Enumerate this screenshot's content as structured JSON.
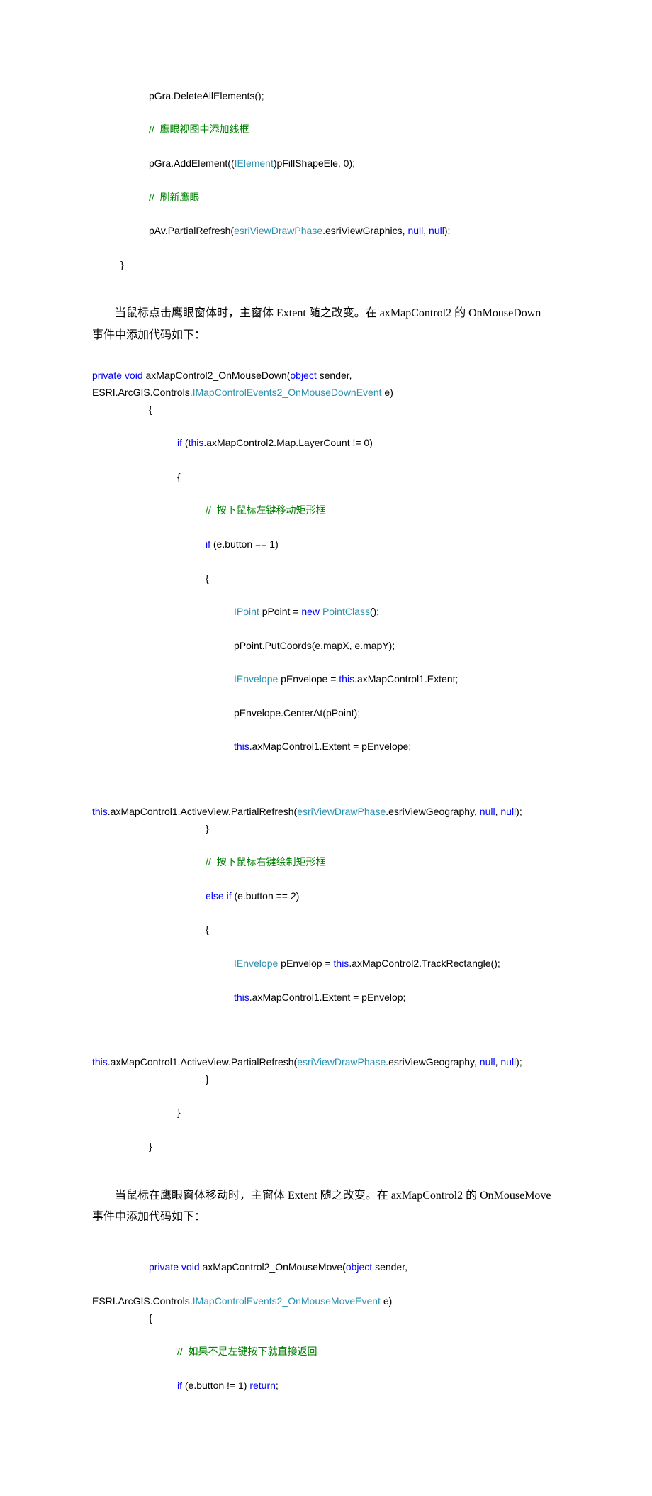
{
  "block1": {
    "l1": "pGra.DeleteAllElements();",
    "l2": "//  鹰眼视图中添加线框",
    "l3a": "pGra.AddElement((",
    "l3b": "IElement",
    "l3c": ")pFillShapeEle, 0);",
    "l4": "//  刷新鹰眼",
    "l5a": "pAv.PartialRefresh(",
    "l5b": "esriViewDrawPhase",
    "l5c": ".esriViewGraphics, ",
    "l5d": "null",
    "l5e": ", ",
    "l5f": "null",
    "l5g": ");",
    "l6": "}"
  },
  "para1": {
    "t1": "当鼠标点击鹰眼窗体时，主窗体 Extent 随之改变。在 axMapControl2 的 OnMouseDown事件中添加代码如下：",
    "t1_first": "当鼠标点击鹰眼窗体时，主窗体 Extent 随之改变。在 axMapControl2 的 OnMouseDown",
    "t1_rest": "事件中添加代码如下："
  },
  "block2": {
    "sig1a": "private",
    "sig1b": " ",
    "sig1c": "void",
    "sig1d": " axMapControl2_OnMouseDown(",
    "sig1e": "object",
    "sig1f": " sender,",
    "sig2a": "ESRI.ArcGIS.Controls.",
    "sig2b": "IMapControlEvents2_OnMouseDownEvent",
    "sig2c": " e)",
    "l1": "{",
    "l2a": "if",
    "l2b": " (",
    "l2c": "this",
    "l2d": ".axMapControl2.Map.LayerCount != 0)",
    "l3": "{",
    "l4": "//  按下鼠标左键移动矩形框",
    "l5a": "if",
    "l5b": " (e.button == 1)",
    "l6": "{",
    "l7a": "IPoint",
    "l7b": " pPoint = ",
    "l7c": "new",
    "l7d": " ",
    "l7e": "PointClass",
    "l7f": "();",
    "l8": "pPoint.PutCoords(e.mapX, e.mapY);",
    "l9a": "IEnvelope",
    "l9b": " pEnvelope = ",
    "l9c": "this",
    "l9d": ".axMapControl1.Extent;",
    "l10": "pEnvelope.CenterAt(pPoint);",
    "l11a": "this",
    "l11b": ".axMapControl1.Extent = pEnvelope;",
    "l12a": "this",
    "l12b": ".axMapControl1.ActiveView.PartialRefresh(",
    "l12c": "esriViewDrawPhase",
    "l12d": ".esriViewGeography, ",
    "l12e": "null",
    "l12f": ", ",
    "l12g": "null",
    "l12h": ");",
    "l13": "}",
    "l14": "//  按下鼠标右键绘制矩形框",
    "l15a": "else",
    "l15b": " ",
    "l15c": "if",
    "l15d": " (e.button == 2)",
    "l16": "{",
    "l17a": "IEnvelope",
    "l17b": " pEnvelop = ",
    "l17c": "this",
    "l17d": ".axMapControl2.TrackRectangle();",
    "l18a": "this",
    "l18b": ".axMapControl1.Extent = pEnvelop;",
    "l19a": "this",
    "l19b": ".axMapControl1.ActiveView.PartialRefresh(",
    "l19c": "esriViewDrawPhase",
    "l19d": ".esriViewGeography, ",
    "l19e": "null",
    "l19f": ", ",
    "l19g": "null",
    "l19h": ");",
    "l20": "}",
    "l21": "}",
    "l22": "}"
  },
  "para2": {
    "t1_first": "当鼠标在鹰眼窗体移动时，主窗体 Extent 随之改变。在 axMapControl2 的 OnMouseMove",
    "t1_rest": "事件中添加代码如下："
  },
  "block3": {
    "sig1a": "private",
    "sig1b": " ",
    "sig1c": "void",
    "sig1d": " axMapControl2_OnMouseMove(",
    "sig1e": "object",
    "sig1f": " sender,",
    "sig2a": "ESRI.ArcGIS.Controls.",
    "sig2b": "IMapControlEvents2_OnMouseMoveEvent",
    "sig2c": " e)",
    "l1": "{",
    "l2": "//  如果不是左键按下就直接返回",
    "l3a": "if",
    "l3b": " (e.button != 1) ",
    "l3c": "return",
    "l3d": ";"
  }
}
